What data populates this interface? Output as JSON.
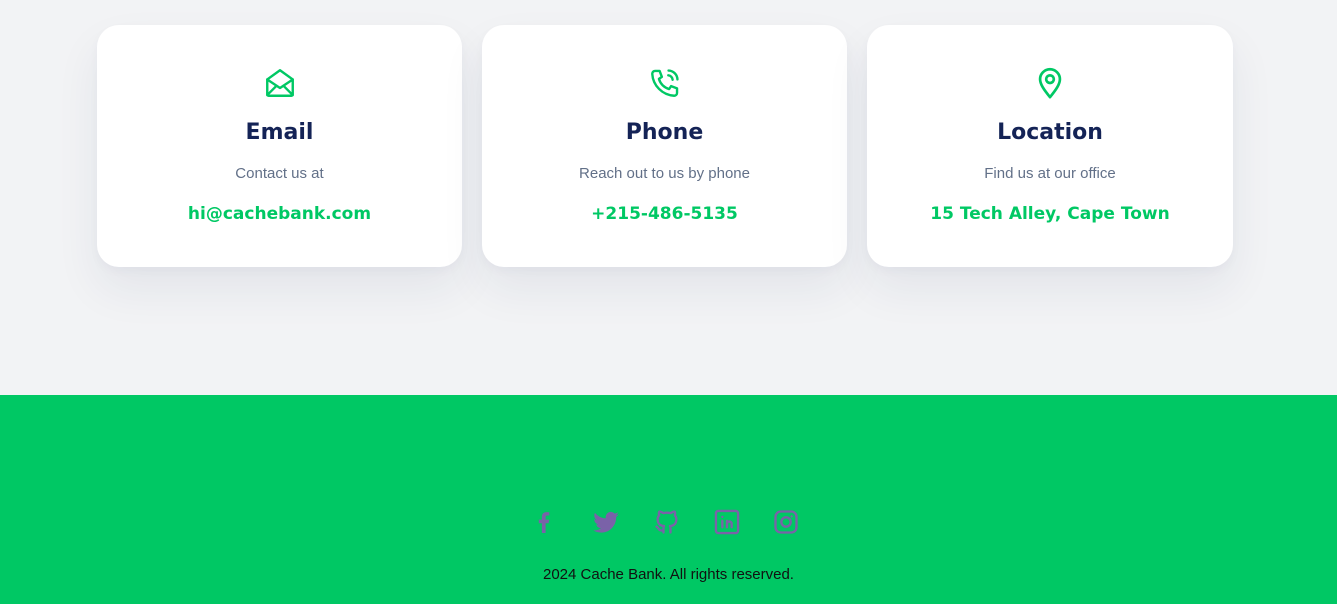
{
  "contact": {
    "cards": [
      {
        "icon": "mail-open-icon",
        "title": "Email",
        "description": "Contact us at",
        "value": "hi@cachebank.com"
      },
      {
        "icon": "phone-call-icon",
        "title": "Phone",
        "description": "Reach out to us by phone",
        "value": "+215-486-5135"
      },
      {
        "icon": "map-pin-icon",
        "title": "Location",
        "description": "Find us at our office",
        "value": "15 Tech Alley, Cape Town"
      }
    ]
  },
  "footer": {
    "social": [
      {
        "icon": "facebook-icon"
      },
      {
        "icon": "twitter-icon"
      },
      {
        "icon": "github-icon"
      },
      {
        "icon": "linkedin-icon"
      },
      {
        "icon": "instagram-icon"
      }
    ],
    "copyright": "2024 Cache Bank. All rights reserved."
  },
  "colors": {
    "accent": "#00c864",
    "heading": "#142356",
    "muted_text": "#627088",
    "page_background": "#f2f3f5",
    "card_background": "#ffffff",
    "social_icon": "#7a62a8"
  }
}
